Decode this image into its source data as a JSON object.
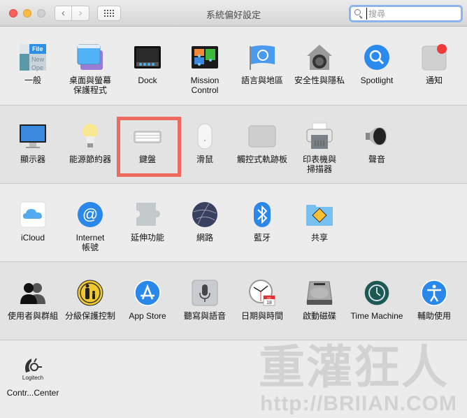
{
  "window": {
    "title": "系統偏好設定",
    "nav_back": "‹",
    "nav_forward": "›",
    "search_placeholder": "搜尋",
    "search_value": ""
  },
  "sections": [
    {
      "items": [
        {
          "label": "一般",
          "icon": "general-icon"
        },
        {
          "label": "桌面與螢幕\n保護程式",
          "icon": "desktop-screensaver-icon"
        },
        {
          "label": "Dock",
          "icon": "dock-icon"
        },
        {
          "label": "Mission\nControl",
          "icon": "mission-control-icon"
        },
        {
          "label": "語言與地區",
          "icon": "language-region-icon"
        },
        {
          "label": "安全性與隱私",
          "icon": "security-privacy-icon"
        },
        {
          "label": "Spotlight",
          "icon": "spotlight-icon"
        },
        {
          "label": "通知",
          "icon": "notifications-icon"
        }
      ]
    },
    {
      "items": [
        {
          "label": "顯示器",
          "icon": "displays-icon"
        },
        {
          "label": "能源節約器",
          "icon": "energy-saver-icon"
        },
        {
          "label": "鍵盤",
          "icon": "keyboard-icon",
          "highlighted": true
        },
        {
          "label": "滑鼠",
          "icon": "mouse-icon"
        },
        {
          "label": "觸控式軌跡板",
          "icon": "trackpad-icon"
        },
        {
          "label": "印表機與\n掃描器",
          "icon": "printer-scanner-icon"
        },
        {
          "label": "聲音",
          "icon": "sound-icon"
        }
      ]
    },
    {
      "items": [
        {
          "label": "iCloud",
          "icon": "icloud-icon"
        },
        {
          "label": "Internet\n帳號",
          "icon": "internet-accounts-icon"
        },
        {
          "label": "延伸功能",
          "icon": "extensions-icon"
        },
        {
          "label": "網路",
          "icon": "network-icon"
        },
        {
          "label": "藍牙",
          "icon": "bluetooth-icon"
        },
        {
          "label": "共享",
          "icon": "sharing-icon"
        }
      ]
    },
    {
      "items": [
        {
          "label": "使用者與群組",
          "icon": "users-groups-icon"
        },
        {
          "label": "分級保護控制",
          "icon": "parental-controls-icon"
        },
        {
          "label": "App Store",
          "icon": "app-store-icon"
        },
        {
          "label": "聽寫與語音",
          "icon": "dictation-speech-icon"
        },
        {
          "label": "日期與時間",
          "icon": "date-time-icon"
        },
        {
          "label": "啟動磁碟",
          "icon": "startup-disk-icon"
        },
        {
          "label": "Time Machine",
          "icon": "time-machine-icon"
        },
        {
          "label": "輔助使用",
          "icon": "accessibility-icon"
        }
      ]
    },
    {
      "items": [
        {
          "label": "Contr...Center",
          "icon": "logitech-control-center-icon"
        }
      ]
    }
  ],
  "icon_text": {
    "general_file": "File",
    "general_new": "New",
    "general_open": "Ope",
    "calendar_month": "JUL",
    "calendar_day": "18",
    "logitech": "Logitech"
  },
  "watermark": {
    "title": "重灌狂人",
    "url": "http://BRIIAN.COM"
  },
  "colors": {
    "highlight": "#ee6a5c",
    "search_focus": "#8cb5ec",
    "section_light": "#ececec",
    "section_dark": "#e3e3e3"
  }
}
